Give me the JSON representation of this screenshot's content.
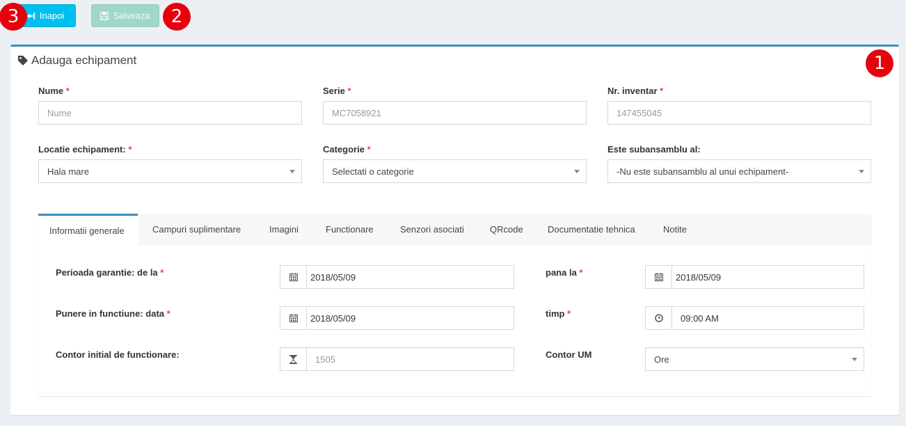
{
  "toolbar": {
    "back_label": "Inapoi",
    "save_label": "Salveaza"
  },
  "badges": [
    "3",
    "2",
    "1"
  ],
  "page": {
    "title": "Adauga echipament"
  },
  "fields": {
    "nume": {
      "label": "Nume",
      "required": "*",
      "placeholder": "Nume"
    },
    "serie": {
      "label": "Serie",
      "required": "*",
      "value": "MC7058921"
    },
    "inventar": {
      "label": "Nr. inventar",
      "required": "*",
      "value": "147455045"
    },
    "locatie": {
      "label": "Locatie echipament:",
      "required": "*",
      "value": "Hala mare"
    },
    "categorie": {
      "label": "Categorie",
      "required": "*",
      "value": "Selectati o categorie"
    },
    "subansamblu": {
      "label": "Este subansamblu al:",
      "value": "-Nu este subansamblu al unui echipament-"
    }
  },
  "tabs": [
    {
      "label": "Informatii generale",
      "active": true
    },
    {
      "label": "Campuri suplimentare"
    },
    {
      "label": "Imagini"
    },
    {
      "label": "Functionare"
    },
    {
      "label": "Senzori asociati"
    },
    {
      "label": "QRcode"
    },
    {
      "label": "Documentatie tehnica"
    },
    {
      "label": "Notite"
    }
  ],
  "general": {
    "garantie_de_la": {
      "label": "Perioada garantie: de la",
      "required": "*",
      "value": "2018/05/09",
      "icon": "calendar-icon"
    },
    "garantie_pana_la": {
      "label": "pana la",
      "required": "*",
      "value": "2018/05/09",
      "icon": "calendar-icon"
    },
    "punere_data": {
      "label": "Punere in functiune: data",
      "required": "*",
      "value": "2018/05/09",
      "icon": "calendar-icon"
    },
    "punere_timp": {
      "label": "timp",
      "required": "*",
      "value": "09:00 AM",
      "icon": "clock-icon"
    },
    "contor_initial": {
      "label": "Contor initial de functionare:",
      "value": "1505",
      "icon": "hourglass-icon"
    },
    "contor_um": {
      "label": "Contor UM",
      "value": "Ore"
    }
  },
  "colors": {
    "primary": "#3c8dbc",
    "info": "#00c0ef",
    "success_disabled": "#9fd8c6",
    "required": "#dd4b39",
    "badge": "#e8000b"
  }
}
